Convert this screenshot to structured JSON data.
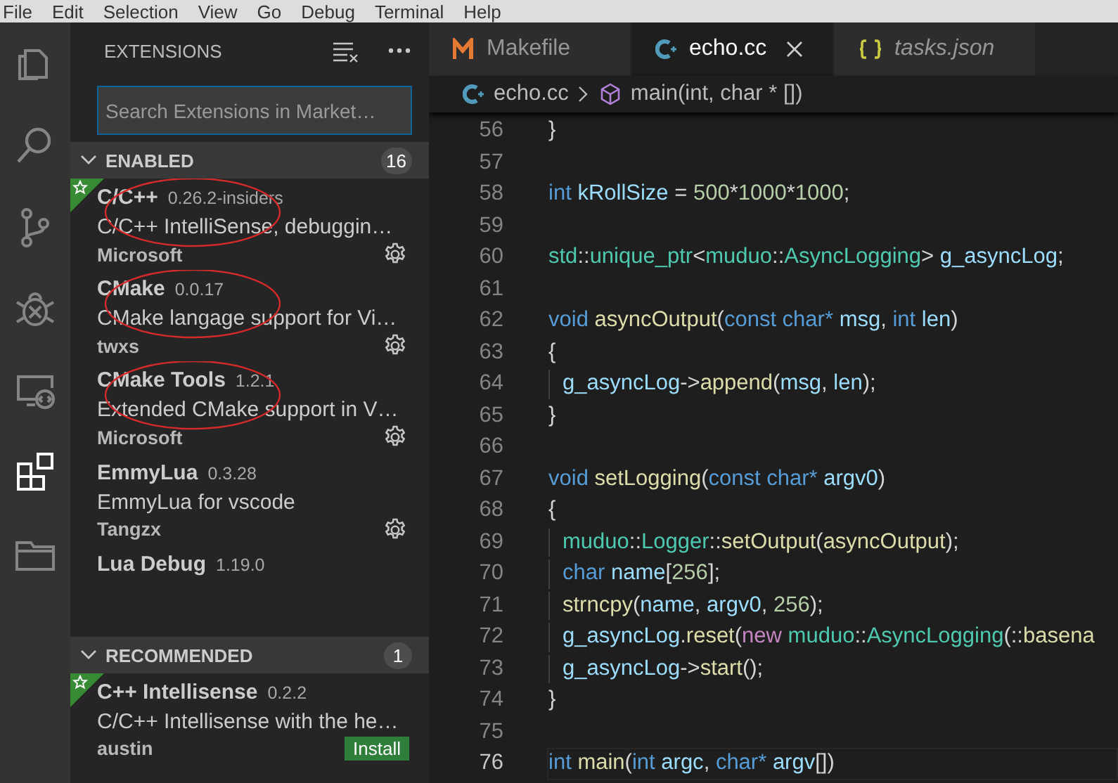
{
  "menu_bar": [
    "File",
    "Edit",
    "Selection",
    "View",
    "Go",
    "Debug",
    "Terminal",
    "Help"
  ],
  "activity_bar": [
    {
      "kind": "files",
      "selected": false
    },
    {
      "kind": "search",
      "selected": false
    },
    {
      "kind": "source-control",
      "selected": false
    },
    {
      "kind": "debug",
      "selected": false
    },
    {
      "kind": "remote",
      "selected": false
    },
    {
      "kind": "extensions",
      "selected": true
    },
    {
      "kind": "folder",
      "selected": false
    }
  ],
  "sidebar": {
    "title": "EXTENSIONS",
    "search": {
      "placeholder": "Search Extensions in Market…"
    },
    "sections": [
      {
        "title": "ENABLED",
        "count": "16",
        "expanded": true,
        "items": [
          {
            "name": "C/C++",
            "version": "0.26.2-insiders",
            "description": "C/C++ IntelliSense, debuggin…",
            "publisher": "Microsoft",
            "starred": true,
            "circled": true,
            "action": {
              "kind": "gear"
            }
          },
          {
            "name": "CMake",
            "version": "0.0.17",
            "description": "CMake langage support for Vi…",
            "publisher": "twxs",
            "starred": false,
            "circled": true,
            "action": {
              "kind": "gear"
            }
          },
          {
            "name": "CMake Tools",
            "version": "1.2.1",
            "description": "Extended CMake support in V…",
            "publisher": "Microsoft",
            "starred": false,
            "circled": true,
            "action": {
              "kind": "gear"
            }
          },
          {
            "name": "EmmyLua",
            "version": "0.3.28",
            "description": "EmmyLua for vscode",
            "publisher": "Tangzx",
            "starred": false,
            "circled": false,
            "action": {
              "kind": "gear"
            }
          },
          {
            "name": "Lua Debug",
            "version": "1.19.0",
            "starred": false,
            "circled": false
          }
        ]
      },
      {
        "title": "RECOMMENDED",
        "count": "1",
        "expanded": true,
        "items": [
          {
            "name": "C++ Intellisense",
            "version": "0.2.2",
            "description": "C/C++ Intellisense with the he…",
            "publisher": "austin",
            "starred": true,
            "circled": false,
            "action": {
              "kind": "install",
              "label": "Install"
            }
          }
        ]
      }
    ]
  },
  "tabs": [
    {
      "label": "Makefile",
      "kind": "makefile",
      "selected": false,
      "preview": false
    },
    {
      "label": "echo.cc",
      "kind": "cpp",
      "selected": true,
      "preview": false
    },
    {
      "label": "tasks.json",
      "kind": "json",
      "selected": false,
      "preview": true
    }
  ],
  "breadcrumb": [
    {
      "label": "echo.cc",
      "kind": "cpp"
    },
    {
      "label": "main(int, char * [])",
      "kind": "method"
    }
  ],
  "code": [
    {
      "number": "56",
      "current": false,
      "indented": false,
      "tokens": [
        {
          "kind": "p",
          "text": "}"
        }
      ]
    },
    {
      "number": "57",
      "current": false,
      "indented": false
    },
    {
      "number": "58",
      "current": false,
      "indented": false,
      "tokens": [
        {
          "kind": "kw",
          "text": "int "
        },
        {
          "kind": "var",
          "text": "kRollSize"
        },
        {
          "kind": "p",
          "text": " = "
        },
        {
          "kind": "num",
          "text": "500"
        },
        {
          "kind": "p",
          "text": "*"
        },
        {
          "kind": "num",
          "text": "1000"
        },
        {
          "kind": "p",
          "text": "*"
        },
        {
          "kind": "num",
          "text": "1000"
        },
        {
          "kind": "p",
          "text": ";"
        }
      ]
    },
    {
      "number": "59",
      "current": false,
      "indented": false
    },
    {
      "number": "60",
      "current": false,
      "indented": false,
      "tokens": [
        {
          "kind": "type",
          "text": "std"
        },
        {
          "kind": "p",
          "text": "::"
        },
        {
          "kind": "type",
          "text": "unique_ptr"
        },
        {
          "kind": "p",
          "text": "<"
        },
        {
          "kind": "type",
          "text": "muduo"
        },
        {
          "kind": "p",
          "text": "::"
        },
        {
          "kind": "type",
          "text": "AsyncLogging"
        },
        {
          "kind": "p",
          "text": "> "
        },
        {
          "kind": "var",
          "text": "g_asyncLog"
        },
        {
          "kind": "p",
          "text": ";"
        }
      ]
    },
    {
      "number": "61",
      "current": false,
      "indented": false
    },
    {
      "number": "62",
      "current": false,
      "indented": false,
      "tokens": [
        {
          "kind": "kw",
          "text": "void "
        },
        {
          "kind": "fn",
          "text": "asyncOutput"
        },
        {
          "kind": "p",
          "text": "("
        },
        {
          "kind": "kw",
          "text": "const char* "
        },
        {
          "kind": "var",
          "text": "msg"
        },
        {
          "kind": "p",
          "text": ", "
        },
        {
          "kind": "kw",
          "text": "int "
        },
        {
          "kind": "var",
          "text": "len"
        },
        {
          "kind": "p",
          "text": ")"
        }
      ]
    },
    {
      "number": "63",
      "current": false,
      "indented": false,
      "tokens": [
        {
          "kind": "p",
          "text": "{"
        }
      ]
    },
    {
      "number": "64",
      "current": false,
      "indented": true,
      "tokens": [
        {
          "kind": "var",
          "text": "g_asyncLog"
        },
        {
          "kind": "p",
          "text": "->"
        },
        {
          "kind": "fn",
          "text": "append"
        },
        {
          "kind": "p",
          "text": "("
        },
        {
          "kind": "var",
          "text": "msg"
        },
        {
          "kind": "p",
          "text": ", "
        },
        {
          "kind": "var",
          "text": "len"
        },
        {
          "kind": "p",
          "text": ");"
        }
      ]
    },
    {
      "number": "65",
      "current": false,
      "indented": false,
      "tokens": [
        {
          "kind": "p",
          "text": "}"
        }
      ]
    },
    {
      "number": "66",
      "current": false,
      "indented": false
    },
    {
      "number": "67",
      "current": false,
      "indented": false,
      "tokens": [
        {
          "kind": "kw",
          "text": "void "
        },
        {
          "kind": "fn",
          "text": "setLogging"
        },
        {
          "kind": "p",
          "text": "("
        },
        {
          "kind": "kw",
          "text": "const char* "
        },
        {
          "kind": "var",
          "text": "argv0"
        },
        {
          "kind": "p",
          "text": ")"
        }
      ]
    },
    {
      "number": "68",
      "current": false,
      "indented": false,
      "tokens": [
        {
          "kind": "p",
          "text": "{"
        }
      ]
    },
    {
      "number": "69",
      "current": false,
      "indented": true,
      "tokens": [
        {
          "kind": "type",
          "text": "muduo"
        },
        {
          "kind": "p",
          "text": "::"
        },
        {
          "kind": "type",
          "text": "Logger"
        },
        {
          "kind": "p",
          "text": "::"
        },
        {
          "kind": "fn",
          "text": "setOutput"
        },
        {
          "kind": "p",
          "text": "("
        },
        {
          "kind": "fn",
          "text": "asyncOutput"
        },
        {
          "kind": "p",
          "text": ");"
        }
      ]
    },
    {
      "number": "70",
      "current": false,
      "indented": true,
      "tokens": [
        {
          "kind": "kw",
          "text": "char "
        },
        {
          "kind": "var",
          "text": "name"
        },
        {
          "kind": "p",
          "text": "["
        },
        {
          "kind": "num",
          "text": "256"
        },
        {
          "kind": "p",
          "text": "];"
        }
      ]
    },
    {
      "number": "71",
      "current": false,
      "indented": true,
      "tokens": [
        {
          "kind": "fn",
          "text": "strncpy"
        },
        {
          "kind": "p",
          "text": "("
        },
        {
          "kind": "var",
          "text": "name"
        },
        {
          "kind": "p",
          "text": ", "
        },
        {
          "kind": "var",
          "text": "argv0"
        },
        {
          "kind": "p",
          "text": ", "
        },
        {
          "kind": "num",
          "text": "256"
        },
        {
          "kind": "p",
          "text": ");"
        }
      ]
    },
    {
      "number": "72",
      "current": false,
      "indented": true,
      "tokens": [
        {
          "kind": "var",
          "text": "g_asyncLog"
        },
        {
          "kind": "p",
          "text": "."
        },
        {
          "kind": "fn",
          "text": "reset"
        },
        {
          "kind": "p",
          "text": "("
        },
        {
          "kind": "ctrl",
          "text": "new "
        },
        {
          "kind": "type",
          "text": "muduo"
        },
        {
          "kind": "p",
          "text": "::"
        },
        {
          "kind": "type",
          "text": "AsyncLogging"
        },
        {
          "kind": "p",
          "text": "(::"
        },
        {
          "kind": "fn",
          "text": "basena"
        }
      ]
    },
    {
      "number": "73",
      "current": false,
      "indented": true,
      "tokens": [
        {
          "kind": "var",
          "text": "g_asyncLog"
        },
        {
          "kind": "p",
          "text": "->"
        },
        {
          "kind": "fn",
          "text": "start"
        },
        {
          "kind": "p",
          "text": "();"
        }
      ]
    },
    {
      "number": "74",
      "current": false,
      "indented": false,
      "tokens": [
        {
          "kind": "p",
          "text": "}"
        }
      ]
    },
    {
      "number": "75",
      "current": false,
      "indented": false
    },
    {
      "number": "76",
      "current": true,
      "indented": false,
      "tokens": [
        {
          "kind": "kw",
          "text": "int "
        },
        {
          "kind": "fn",
          "text": "main"
        },
        {
          "kind": "p",
          "text": "("
        },
        {
          "kind": "kw",
          "text": "int "
        },
        {
          "kind": "var",
          "text": "argc"
        },
        {
          "kind": "p",
          "text": ", "
        },
        {
          "kind": "kw",
          "text": "char* "
        },
        {
          "kind": "var",
          "text": "argv"
        },
        {
          "kind": "p",
          "text": "[])"
        }
      ]
    }
  ]
}
